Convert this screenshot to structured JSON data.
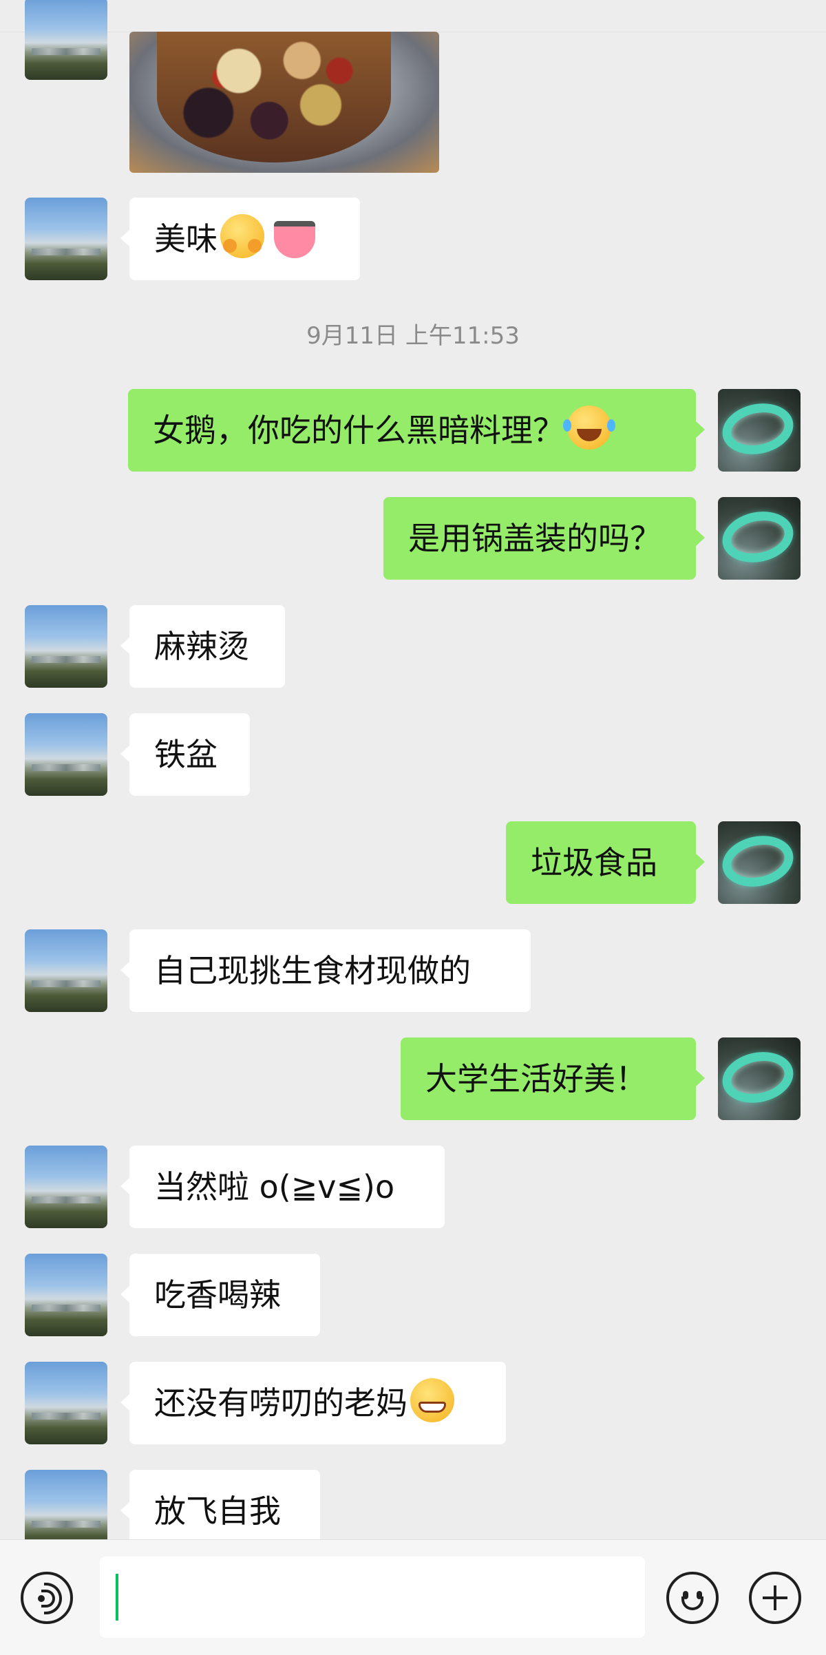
{
  "conversation": {
    "timestamp": "9月11日 上午11:53",
    "messages": [
      {
        "side": "in",
        "text": "美味",
        "emojis": [
          "hugging-face",
          "tongue"
        ]
      },
      {
        "side": "out",
        "text": "女鹅，你吃的什么黑暗料理？",
        "emojis": [
          "tears-of-joy"
        ]
      },
      {
        "side": "out",
        "text": "是用锅盖装的吗？"
      },
      {
        "side": "in",
        "text": "麻辣烫"
      },
      {
        "side": "in",
        "text": "铁盆"
      },
      {
        "side": "out",
        "text": "垃圾食品"
      },
      {
        "side": "in",
        "text": "自己现挑生食材现做的"
      },
      {
        "side": "out",
        "text": "大学生活好美！"
      },
      {
        "side": "in",
        "text": "当然啦 o(≧v≦)o"
      },
      {
        "side": "in",
        "text": "吃香喝辣"
      },
      {
        "side": "in",
        "text": "还没有唠叨的老妈",
        "emojis": [
          "grinning-face"
        ]
      },
      {
        "side": "in",
        "text": "放飞自我"
      }
    ]
  },
  "input_bar": {
    "value": "",
    "icons": [
      "voice-icon",
      "emoji-icon",
      "plus-icon"
    ]
  },
  "colors": {
    "background": "#ededed",
    "outgoing_bubble": "#95ec69",
    "incoming_bubble": "#ffffff",
    "caret": "#07c160"
  }
}
